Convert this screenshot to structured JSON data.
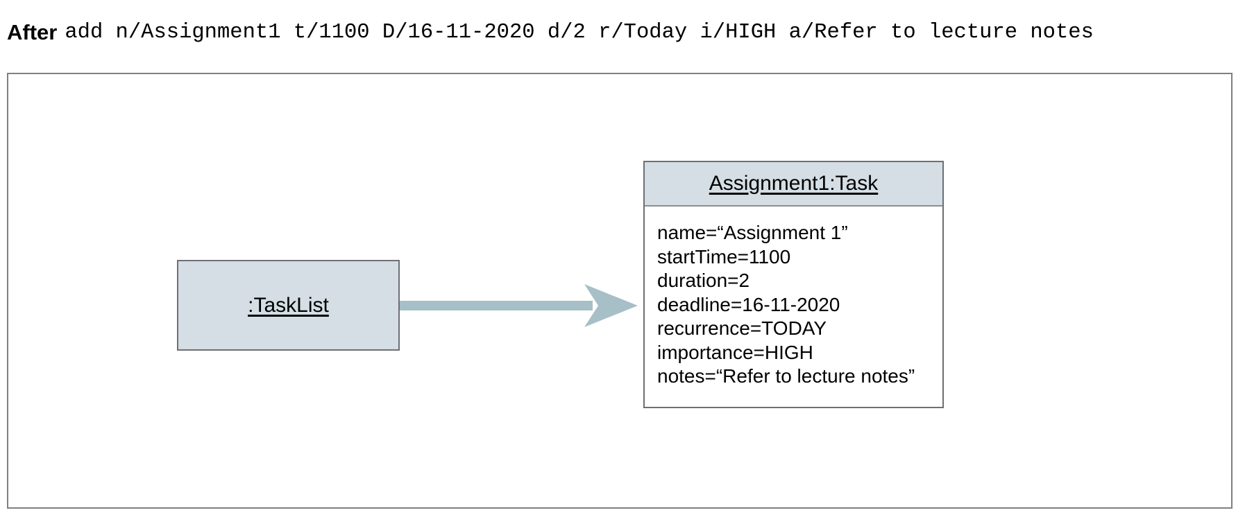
{
  "caption": {
    "lead_label": "After",
    "command": "add n/Assignment1 t/1100 D/16-11-2020 d/2 r/Today i/HIGH a/Refer to lecture notes"
  },
  "diagram": {
    "type": "uml-object-diagram",
    "colors": {
      "object_fill": "#d4dee4",
      "object_border": "#6e6e73",
      "frame_border": "#7f7f84",
      "arrow": "#a7bfc6",
      "text": "#000000",
      "background": "#ffffff"
    },
    "objects": [
      {
        "id": "tasklist",
        "title": ":TaskList",
        "attributes": []
      },
      {
        "id": "task",
        "title": "Assignment1:Task",
        "attributes": [
          "name=“Assignment 1”",
          "startTime=1100",
          "duration=2",
          "deadline=16-11-2020",
          "recurrence=TODAY",
          "importance=HIGH",
          "notes=“Refer to lecture notes”"
        ]
      }
    ],
    "links": [
      {
        "id": "tasklist-to-task",
        "from": ":TaskList",
        "to": "Assignment1:Task",
        "style": "solid-arrow"
      }
    ]
  }
}
